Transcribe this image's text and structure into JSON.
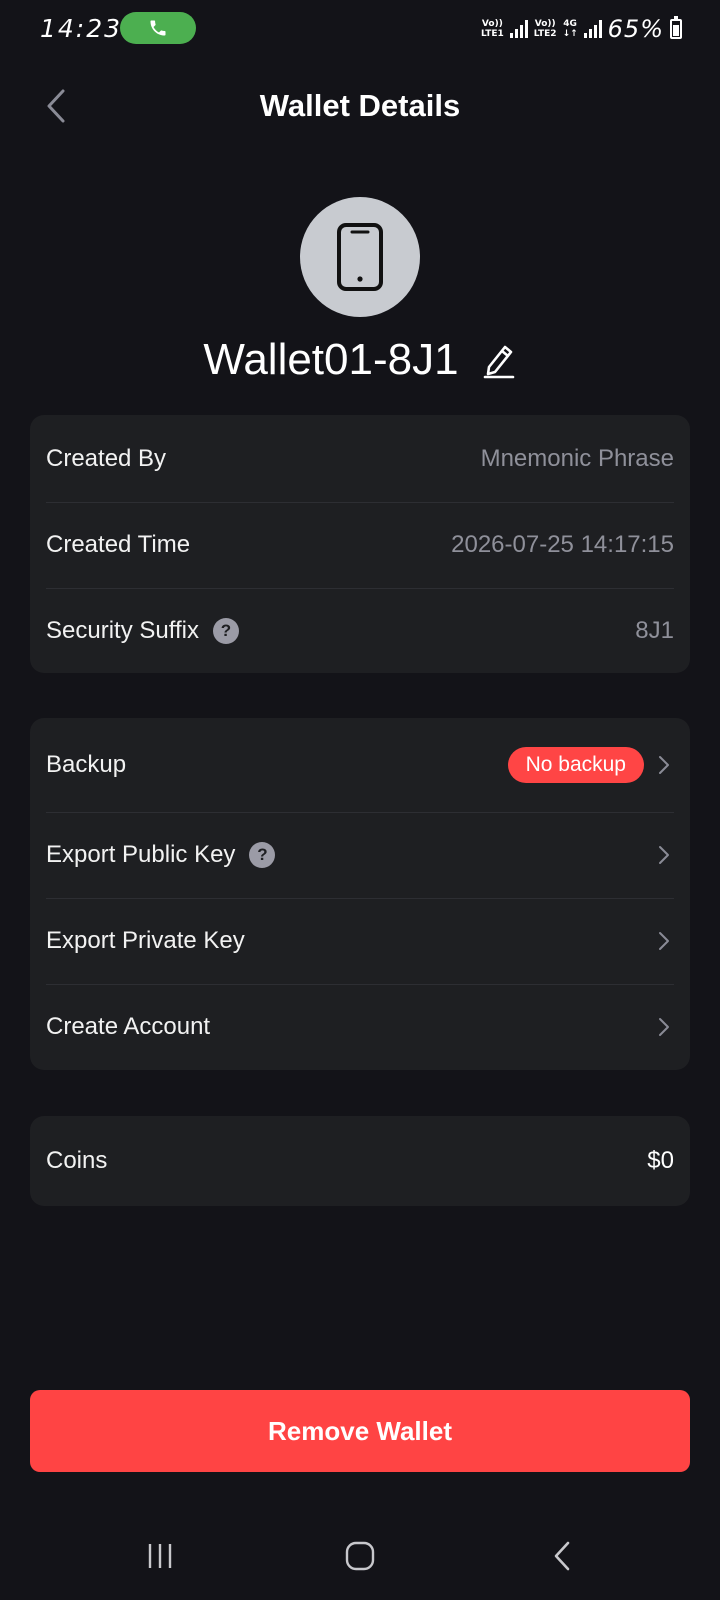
{
  "status_bar": {
    "time": "14:23",
    "sim1_label": "Vo))\nLTE1",
    "sim2_label": "Vo))\nLTE2",
    "network_type": "4G",
    "battery_percent": "65%"
  },
  "header": {
    "title": "Wallet Details"
  },
  "wallet": {
    "name": "Wallet01-8J1",
    "icon": "smartphone-icon"
  },
  "info": {
    "created_by_label": "Created By",
    "created_by_value": "Mnemonic Phrase",
    "created_time_label": "Created Time",
    "created_time_value": "2026-07-25 14:17:15",
    "security_suffix_label": "Security Suffix",
    "security_suffix_value": "8J1"
  },
  "actions": {
    "backup_label": "Backup",
    "backup_badge": "No backup",
    "export_public_key_label": "Export Public Key",
    "export_private_key_label": "Export Private Key",
    "create_account_label": "Create Account"
  },
  "coins": {
    "label": "Coins",
    "value": "$0"
  },
  "remove_button": "Remove Wallet",
  "colors": {
    "background": "#131318",
    "card": "#1e1f22",
    "danger": "#ff4444",
    "call_pill": "#4caf50",
    "muted_text": "#8f909a"
  }
}
